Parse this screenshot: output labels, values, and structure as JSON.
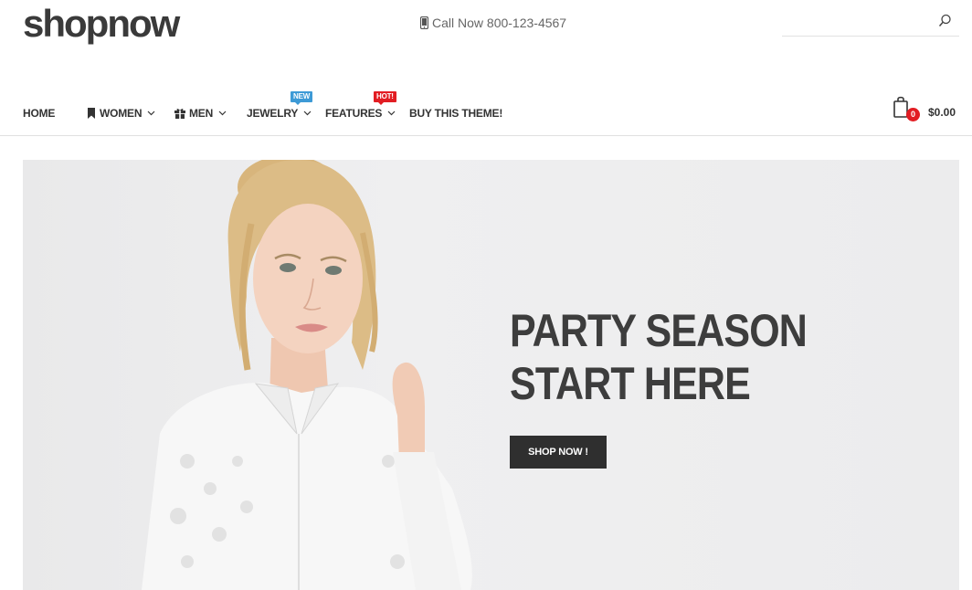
{
  "header": {
    "logo": "shopnow",
    "call_text": "Call Now 800-123-4567",
    "search_placeholder": ""
  },
  "nav": {
    "items": [
      {
        "label": "HOME"
      },
      {
        "label": "WOMEN"
      },
      {
        "label": "MEN"
      },
      {
        "label": "JEWELRY",
        "badge": "NEW"
      },
      {
        "label": "FEATURES",
        "badge": "HOT!"
      },
      {
        "label": "BUY THIS THEME!"
      }
    ]
  },
  "cart": {
    "count": "0",
    "total": "$0.00"
  },
  "hero": {
    "title_line1": "PARTY SEASON",
    "title_line2": "START HERE",
    "button": "SHOP NOW !"
  },
  "colors": {
    "badge_new": "#3d9ad6",
    "badge_hot": "#e21d23",
    "cart_badge": "#e21d23",
    "button_bg": "#2f2f2f",
    "hero_bg": "#ececed"
  },
  "icons": [
    "phone-icon",
    "search-icon",
    "bookmark-icon",
    "gift-icon",
    "chevron-down-icon",
    "shopping-bag-icon"
  ]
}
